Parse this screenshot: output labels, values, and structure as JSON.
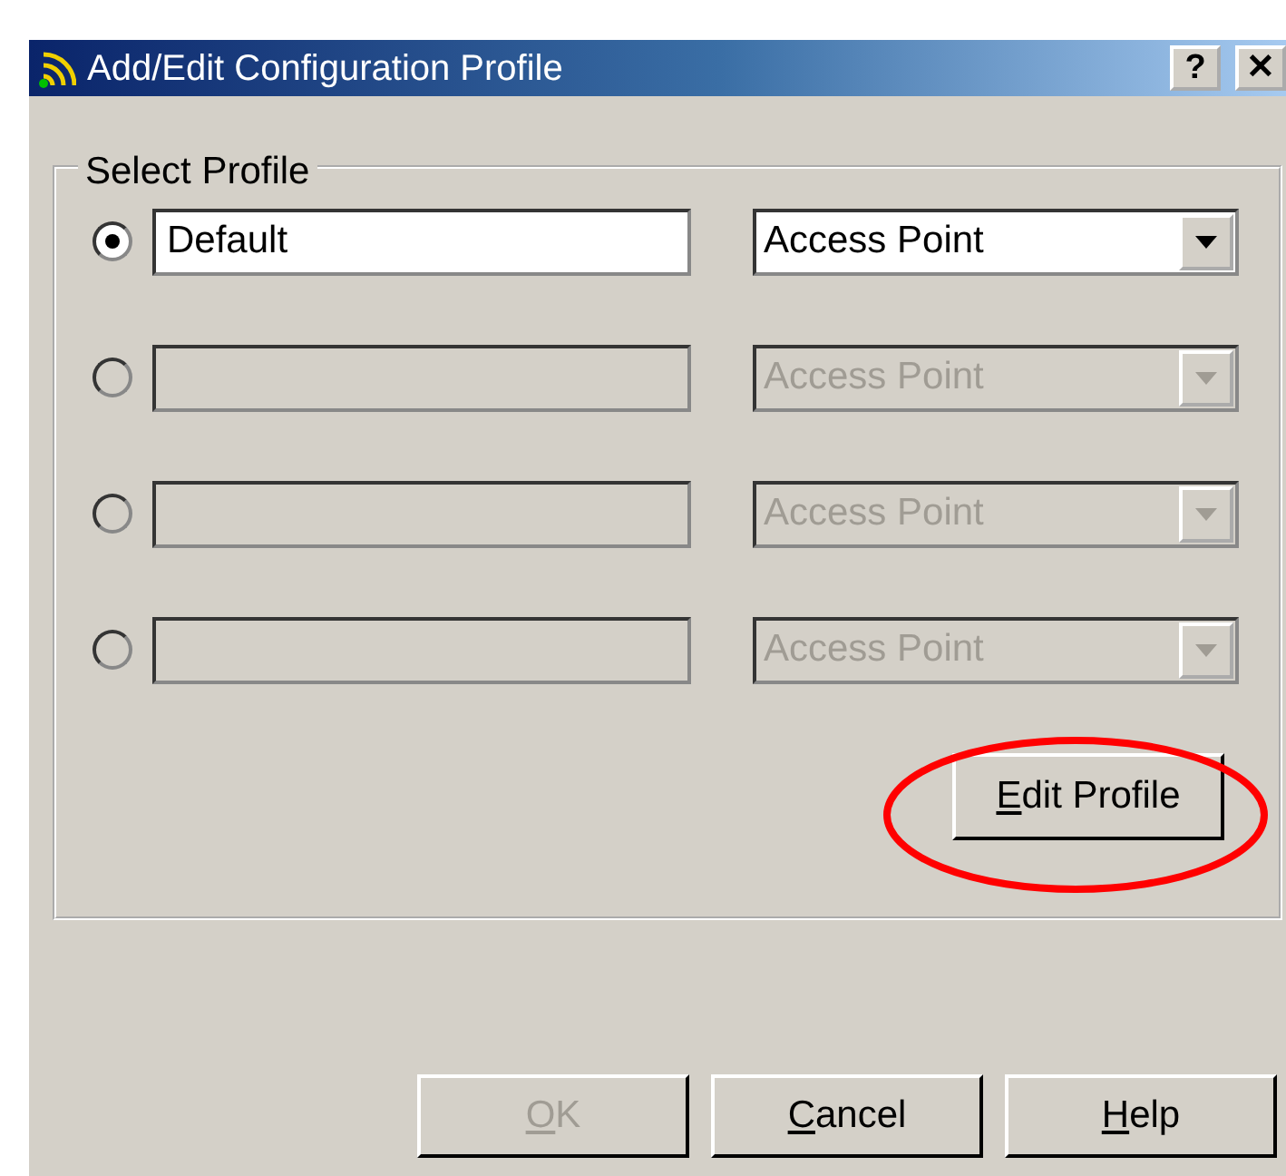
{
  "window": {
    "title": "Add/Edit Configuration Profile",
    "help_button": "?",
    "close_button": "✕"
  },
  "group": {
    "label": "Select Profile",
    "profiles": [
      {
        "selected": true,
        "disabled": false,
        "name": "Default",
        "mode": "Access Point"
      },
      {
        "selected": false,
        "disabled": true,
        "mode": "Access Point"
      },
      {
        "selected": false,
        "disabled": true,
        "mode": "Access Point"
      },
      {
        "selected": false,
        "disabled": true,
        "mode": "Access Point"
      }
    ],
    "edit_button": {
      "label": "Edit Profile",
      "disabled": false
    }
  },
  "annotation": {
    "kind": "ellipse"
  },
  "buttons": [
    {
      "label": "OK",
      "disabled": true
    },
    {
      "label": "Cancel",
      "disabled": false
    },
    {
      "label": "Help",
      "disabled": false
    }
  ]
}
